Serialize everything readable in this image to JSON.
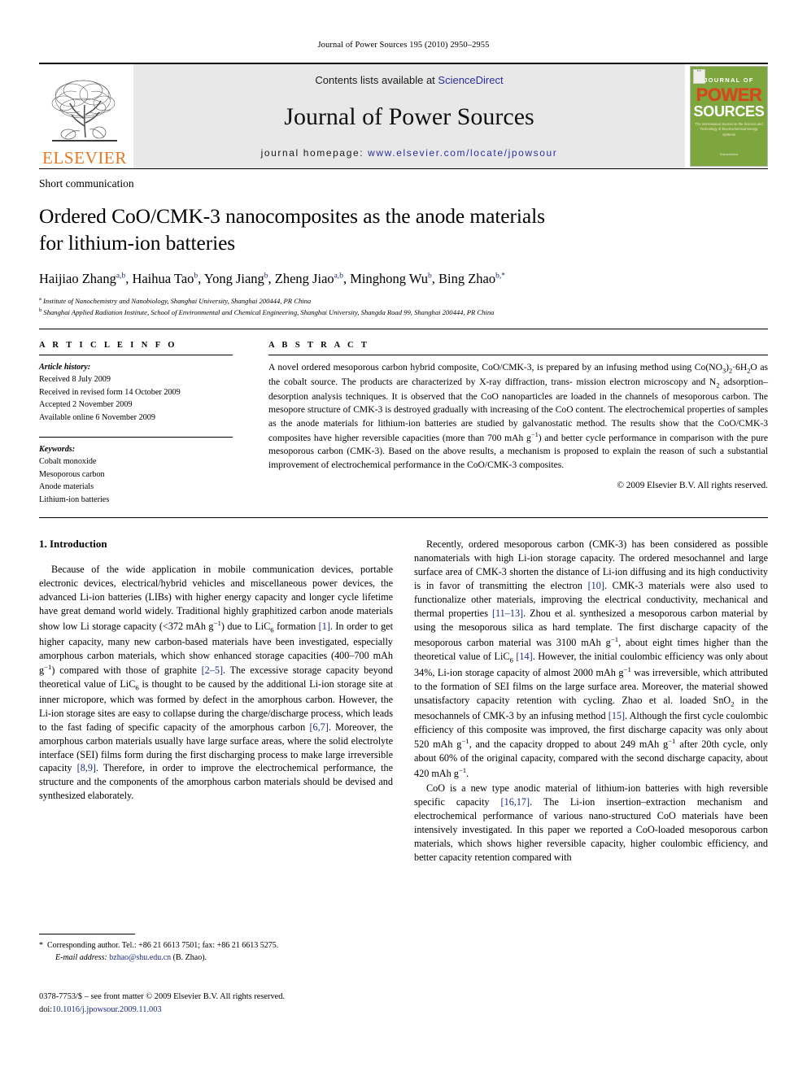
{
  "running_head": "Journal of Power Sources 195 (2010) 2950–2955",
  "masthead": {
    "publisher_name": "ELSEVIER",
    "contents_prefix": "Contents lists available at ",
    "contents_link": "ScienceDirect",
    "journal_title": "Journal of Power Sources",
    "homepage_prefix": "journal homepage: ",
    "homepage_url": "www.elsevier.com/locate/jpowsour",
    "cover": {
      "line1": "JOURNAL OF",
      "line2": "POWER",
      "line3": "SOURCES",
      "subtitle": "The International Journal on the Science and Technology of Electrochemical Energy Systems",
      "bottom": "ScienceDirect"
    },
    "accent_orange": "#E87722",
    "link_blue": "#2b2f9e",
    "cover_green": "#7ea63e",
    "cover_orange": "#D4481B"
  },
  "article": {
    "doctype": "Short communication",
    "title_line1": "Ordered CoO/CMK-3 nanocomposites as the anode materials",
    "title_line2": "for lithium-ion batteries",
    "authors": [
      {
        "name": "Haijiao Zhang",
        "marks": "a,b"
      },
      {
        "name": "Haihua Tao",
        "marks": "b"
      },
      {
        "name": "Yong Jiang",
        "marks": "b"
      },
      {
        "name": "Zheng Jiao",
        "marks": "a,b"
      },
      {
        "name": "Minghong Wu",
        "marks": "b"
      },
      {
        "name": "Bing Zhao",
        "marks": "b,*"
      }
    ],
    "affiliations": [
      {
        "mark": "a",
        "text": "Institute of Nanochemistry and Nanobiology, Shanghai University, Shanghai 200444, PR China"
      },
      {
        "mark": "b",
        "text": "Shanghai Applied Radiation Institute, School of Environmental and Chemical Engineering, Shanghai University, Shangda Road 99, Shanghai 200444, PR China"
      }
    ]
  },
  "article_info": {
    "heading": "A R T I C L E   I N F O",
    "history_label": "Article history:",
    "history": [
      "Received 8 July 2009",
      "Received in revised form 14 October 2009",
      "Accepted 2 November 2009",
      "Available online 6 November 2009"
    ],
    "keywords_label": "Keywords:",
    "keywords": [
      "Cobalt monoxide",
      "Mesoporous carbon",
      "Anode materials",
      "Lithium-ion batteries"
    ]
  },
  "abstract": {
    "heading": "A B S T R A C T",
    "copyright": "© 2009 Elsevier B.V. All rights reserved."
  },
  "intro": {
    "section_title": "1. Introduction"
  },
  "footnote": {
    "corresponding": "Corresponding author. Tel.: +86 21 6613 7501; fax: +86 21 6613 5275.",
    "email_label": "E-mail address:",
    "email": "bzhao@shu.edu.cn",
    "email_owner": "(B. Zhao)."
  },
  "footer": {
    "issn_line": "0378-7753/$ – see front matter © 2009 Elsevier B.V. All rights reserved.",
    "doi_label": "doi:",
    "doi": "10.1016/j.jpowsour.2009.11.003"
  }
}
